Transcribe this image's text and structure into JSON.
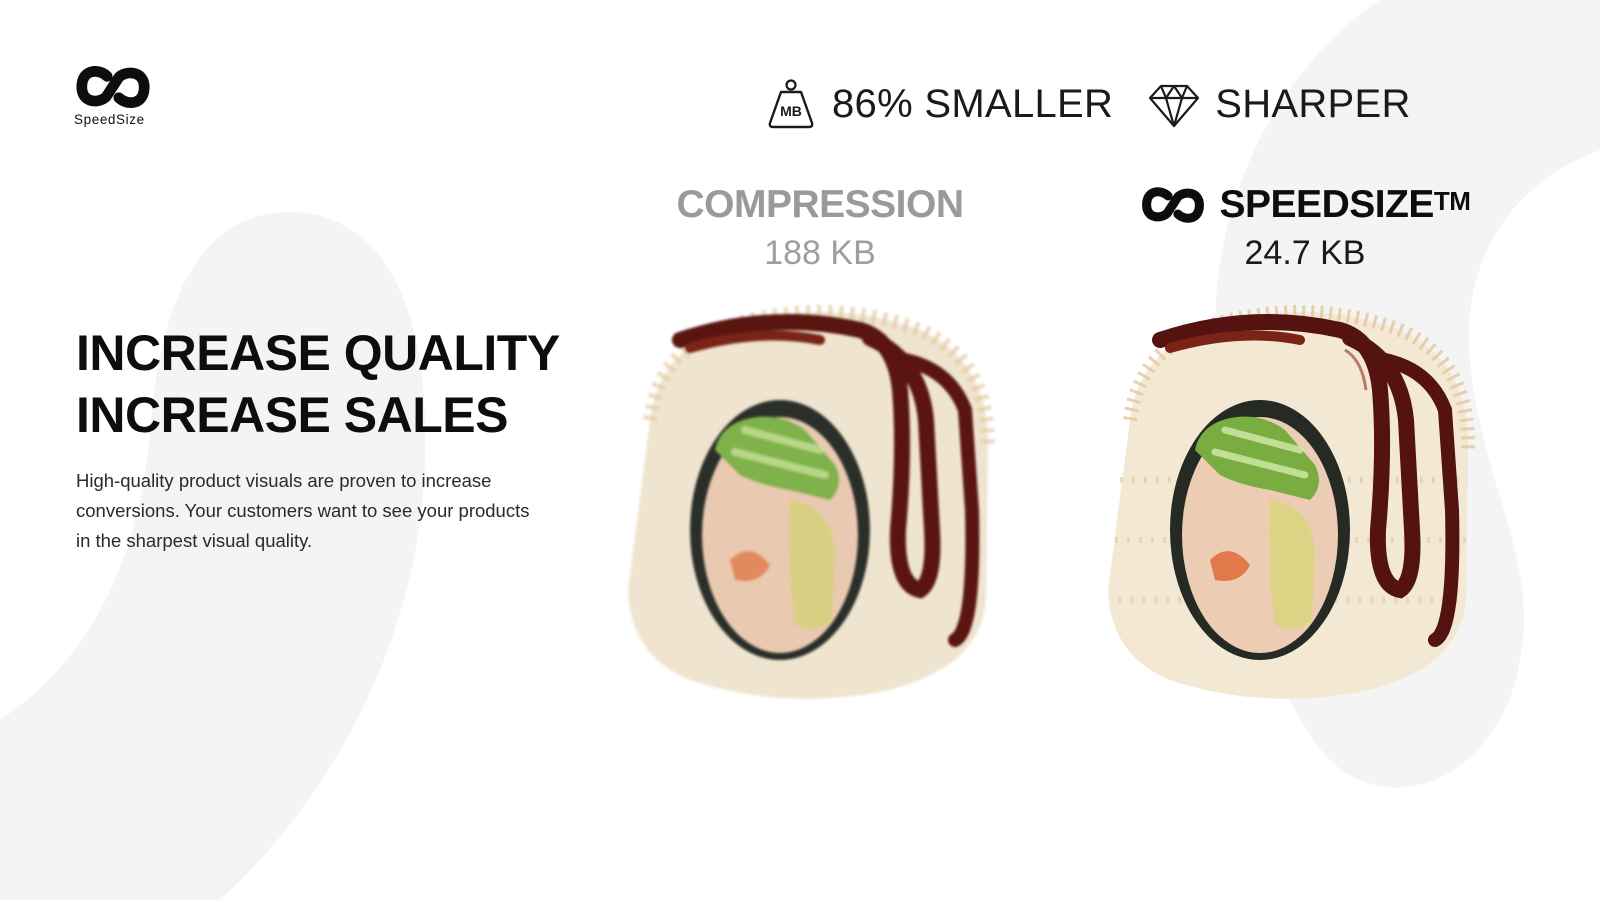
{
  "brand": {
    "name": "SpeedSize"
  },
  "features": [
    {
      "icon": "weight-mb-icon",
      "badge": "MB",
      "label": "86% SMALLER"
    },
    {
      "icon": "diamond-icon",
      "label": "SHARPER"
    }
  ],
  "hero": {
    "line1": "INCREASE QUALITY",
    "line2": "INCREASE SALES",
    "description": "High-quality product visuals are proven to increase conversions. Your customers want to see your products in the sharpest visual quality."
  },
  "comparison": {
    "compression": {
      "title": "COMPRESSION",
      "size": "188 KB"
    },
    "speedsize": {
      "title": "SPEEDSIZE",
      "trademark": "TM",
      "size": "24.7 KB"
    }
  },
  "colors": {
    "text": "#0d0d0d",
    "muted": "#9a9a9a",
    "background_swirl": "#f4f4f4",
    "sauce": "#5a1510",
    "cucumber": "#7fb24a"
  }
}
